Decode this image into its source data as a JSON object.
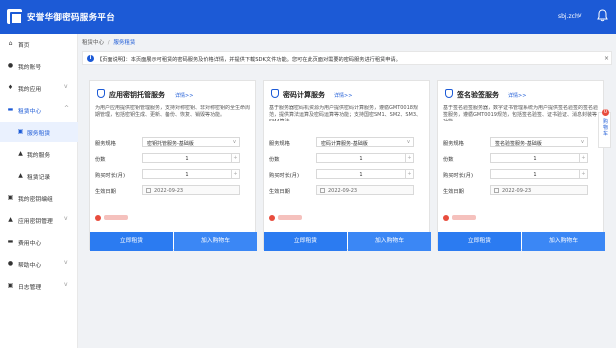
{
  "header": {
    "app_title": "安誉华御密码服务平台",
    "user": "sbj.zch",
    "user_caret": "v",
    "colors": {
      "primary": "#1c5ad6",
      "button": "#2b7bf1",
      "price": "#e84c3d"
    }
  },
  "sidebar": {
    "items": [
      {
        "icon": "home-icon",
        "glyph": "⌂",
        "label": "首页"
      },
      {
        "icon": "user-icon",
        "glyph": "●",
        "label": "我的账号"
      },
      {
        "icon": "app-icon",
        "glyph": "♦",
        "label": "我的应用",
        "chevron": "v"
      },
      {
        "icon": "lease-icon",
        "glyph": "▬",
        "label": "租赁中心",
        "chevron": "^"
      },
      {
        "icon": "service-lease-icon",
        "glyph": "▣",
        "label": "服务租赁"
      },
      {
        "icon": "my-service-icon",
        "glyph": "▲",
        "label": "我的服务"
      },
      {
        "icon": "lease-record-icon",
        "glyph": "▲",
        "label": "租赁记录"
      },
      {
        "icon": "key-manage-icon",
        "glyph": "▣",
        "label": "我的密钥编组"
      },
      {
        "icon": "app-key-icon",
        "glyph": "▲",
        "label": "应用密钥管理",
        "chevron": "v"
      },
      {
        "icon": "fee-icon",
        "glyph": "▬",
        "label": "费用中心"
      },
      {
        "icon": "help-icon",
        "glyph": "●",
        "label": "帮助中心",
        "chevron": "v"
      },
      {
        "icon": "log-icon",
        "glyph": "▣",
        "label": "日志管理",
        "chevron": "v"
      }
    ],
    "menu_glyph": "≡"
  },
  "breadcrumb": {
    "parent": "租赁中心",
    "separator": "/",
    "current": "服务租赁"
  },
  "notice": {
    "text": "【页面说明】：本页面展示可租赁的密码服务及价格详情，并提供下载SDK文件功能。您可在此页面对需要的密码服务进行租赁申请。",
    "close": "×"
  },
  "cards": [
    {
      "title": "应用密钥托管服务",
      "detail": "详情>>",
      "desc": "为用户应用提供密钥管理服务，支持对称密钥、非对称密钥的全生命周期管理，包括密钥生成、更新、备份、恢复、销毁等功能。",
      "spec_label": "服务规格",
      "spec_value": "密钥托管服务-基础版",
      "count_label": "份数",
      "count_value": "1",
      "duration_label": "购买时长(月)",
      "duration_value": "1",
      "date_label": "生效日期",
      "date_value": "2022-09-23",
      "btn_lease": "立即租赁",
      "btn_cart": "加入购物车"
    },
    {
      "title": "密码计算服务",
      "detail": "详情>>",
      "desc": "基于服务器密码机资源为用户提供密码计算服务，遵循GMT0018规范，提供算法运算及密码运算等功能；支持国密SM1、SM2、SM3、SM4算法。",
      "spec_label": "服务规格",
      "spec_value": "密码计算服务-基础版",
      "count_label": "份数",
      "count_value": "1",
      "duration_label": "购买时长(月)",
      "duration_value": "1",
      "date_label": "生效日期",
      "date_value": "2022-09-23",
      "btn_lease": "立即租赁",
      "btn_cart": "加入购物车"
    },
    {
      "title": "签名验签服务",
      "detail": "详情>>",
      "desc": "基于签名验签服务器，数字证书管理系统为用户提供签名验签的签名验签服务，遵循GMT0019规范，包括签名验签、证书验证、消息封装等功能。",
      "spec_label": "服务规格",
      "spec_value": "签名验签服务-基础版",
      "count_label": "份数",
      "count_value": "1",
      "duration_label": "购买时长(月)",
      "duration_value": "1",
      "date_label": "生效日期",
      "date_value": "2022-09-23",
      "btn_lease": "立即租赁",
      "btn_cart": "加入购物车"
    }
  ],
  "float_tab": {
    "badge": "0",
    "text": "购物车"
  },
  "stepper": {
    "minus": "−",
    "plus": "+",
    "caret": "v"
  }
}
